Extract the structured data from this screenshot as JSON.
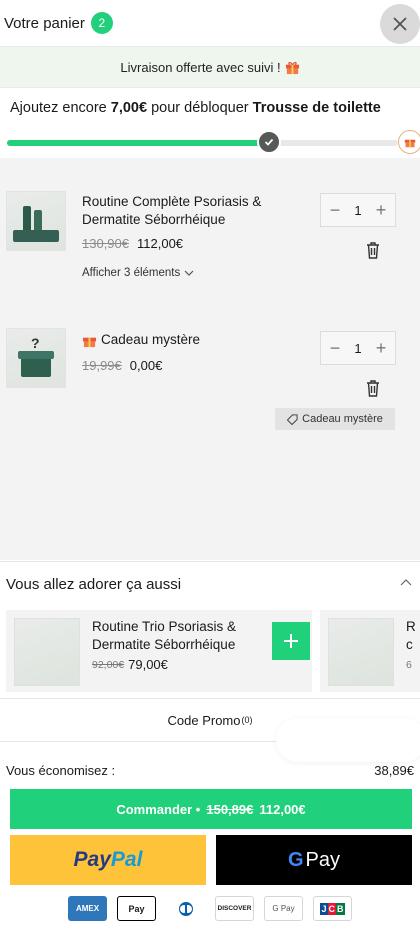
{
  "header": {
    "title": "Votre panier",
    "count": "2"
  },
  "banner": {
    "text": "Livraison offerte avec suivi !",
    "icon": "gift-icon"
  },
  "progress": {
    "prefix": "Ajoutez encore ",
    "amount": "7,00€",
    "middle": " pour débloquer ",
    "reward": "Trousse de toilette",
    "fill_fraction": 0.67
  },
  "items": [
    {
      "name": "Routine Complète Psoriasis & Dermatite Séborrhéique",
      "old_price": "130,90€",
      "price": "112,00€",
      "qty": "1",
      "toggle": "Afficher 3 éléments"
    },
    {
      "name": "Cadeau mystère",
      "old_price": "19,99€",
      "price": "0,00€",
      "qty": "1",
      "tag": "Cadeau mystère"
    }
  ],
  "reco": {
    "title": "Vous allez adorer ça aussi",
    "cards": [
      {
        "name": "Routine Trio Psoriasis & Dermatite Séborrhéique",
        "old_price": "92,00€",
        "price": "79,00€"
      },
      {
        "name_partial_1": "R",
        "name_partial_2": "c",
        "price_partial": "6"
      }
    ]
  },
  "promo": {
    "label": "Code Promo",
    "count": "(0)"
  },
  "savings": {
    "label": "Vous économisez :",
    "value": "38,89€"
  },
  "checkout": {
    "label": "Commander •",
    "old_total": "150,89€",
    "total": "112,00€"
  },
  "payment": {
    "paypal_1": "Pay",
    "paypal_2": "Pal",
    "gpay_g": "G",
    "gpay_text": "Pay",
    "icons": [
      "AMEX",
      "Pay",
      "Diners",
      "DISCOVER",
      "G Pay",
      "JCB"
    ]
  },
  "colors": {
    "accent": "#21d07a",
    "banner_bg": "#eef6ee",
    "paypal": "#ffc33a"
  }
}
